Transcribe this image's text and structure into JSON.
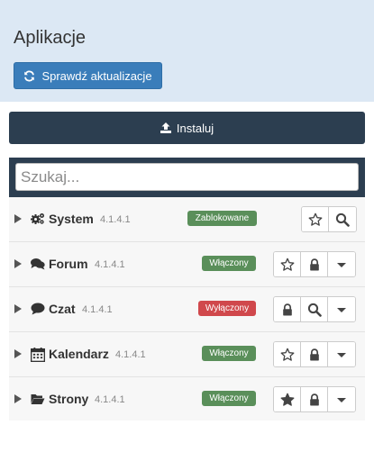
{
  "header": {
    "title": "Aplikacje",
    "update_button_label": "Sprawdź aktualizacje"
  },
  "install_button_label": "Instaluj",
  "search": {
    "placeholder": "Szukaj...",
    "value": ""
  },
  "apps": [
    {
      "name": "System",
      "version": "4.1.4.1",
      "icon": "cogs-icon",
      "status": "Zablokowane",
      "status_color": "#5a8f5a",
      "actions": [
        "star-outline-icon",
        "search-icon"
      ]
    },
    {
      "name": "Forum",
      "version": "4.1.4.1",
      "icon": "comments-icon",
      "status": "Włączony",
      "status_color": "#5a8f5a",
      "actions": [
        "star-outline-icon",
        "lock-icon",
        "caret-down-icon"
      ]
    },
    {
      "name": "Czat",
      "version": "4.1.4.1",
      "icon": "comment-icon",
      "status": "Wyłączony",
      "status_color": "#d0484c",
      "actions": [
        "lock-icon",
        "search-icon",
        "caret-down-icon"
      ]
    },
    {
      "name": "Kalendarz",
      "version": "4.1.4.1",
      "icon": "calendar-icon",
      "status": "Włączony",
      "status_color": "#5a8f5a",
      "actions": [
        "star-outline-icon",
        "lock-icon",
        "caret-down-icon"
      ]
    },
    {
      "name": "Strony",
      "version": "4.1.4.1",
      "icon": "folder-open-icon",
      "status": "Włączony",
      "status_color": "#5a8f5a",
      "actions": [
        "star-filled-icon",
        "lock-icon",
        "caret-down-icon"
      ]
    }
  ],
  "colors": {
    "header_bg": "#dce8f4",
    "primary": "#3a7dba",
    "dark": "#2c3e50"
  }
}
